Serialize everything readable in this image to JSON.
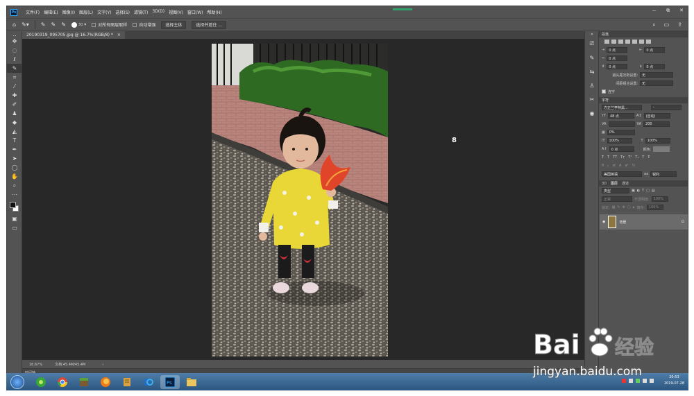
{
  "menu": {
    "items": [
      "文件(F)",
      "编辑(E)",
      "图像(I)",
      "图层(L)",
      "文字(Y)",
      "选择(S)",
      "滤镜(T)",
      "3D(D)",
      "视图(V)",
      "窗口(W)",
      "帮助(H)"
    ],
    "window_controls": [
      "－",
      "⧉",
      "✕"
    ]
  },
  "options": {
    "brush_size": "30",
    "sample_all_layers": "对所有图层取样",
    "auto_enhance": "自动增强",
    "select_subject": "选择主体",
    "select_and_mask": "选择并遮住 ..."
  },
  "document": {
    "tab_title": "20190319_095705.jpg @ 16.7%(RGB/8) *",
    "close": "×"
  },
  "status": {
    "zoom": "16.67%",
    "doc_info": "文档:45.4M/45.4M",
    "arrow": "›",
    "timeline": "时间轴"
  },
  "paragraph_panel": {
    "title": "段落",
    "indent_left": "0 点",
    "indent_right": "0 点",
    "first_line": "0 点",
    "space_before": "0 点",
    "space_after": "0 点",
    "kinsoku_label": "避头尾法则设置:",
    "kinsoku_value": "无",
    "mojikumi_label": "间距组合设置:",
    "mojikumi_value": "无",
    "hyphenate": "连字"
  },
  "character_panel": {
    "title": "字符",
    "font_family": "方正兰亭特黑...",
    "font_style": "-",
    "size": "48 点",
    "leading": "(自动)",
    "kerning": "",
    "tracking": "200",
    "tsume": "0%",
    "vscale": "100%",
    "hscale": "100%",
    "baseline": "0 点",
    "color_label": "颜色:",
    "language": "美国英语",
    "aa_label": "aa",
    "antialias": "锐利"
  },
  "layers_panel": {
    "tabs": [
      "3D",
      "图层",
      "通道"
    ],
    "kind": "类型",
    "blend": "正常",
    "opacity_label": "不透明度:",
    "opacity": "100%",
    "lock_label": "锁定:",
    "fill_label": "填充:",
    "fill": "100%",
    "layer_name": "背景"
  },
  "taskbar": {
    "time": "20:53",
    "date": "2019-07-28"
  },
  "watermark": {
    "logo": "Bai",
    "suffix": "经验",
    "url": "jingyan.baidu.com"
  },
  "colors": {
    "ps_gray": "#535353",
    "canvas": "#282828",
    "accent": "#31a8ff"
  }
}
